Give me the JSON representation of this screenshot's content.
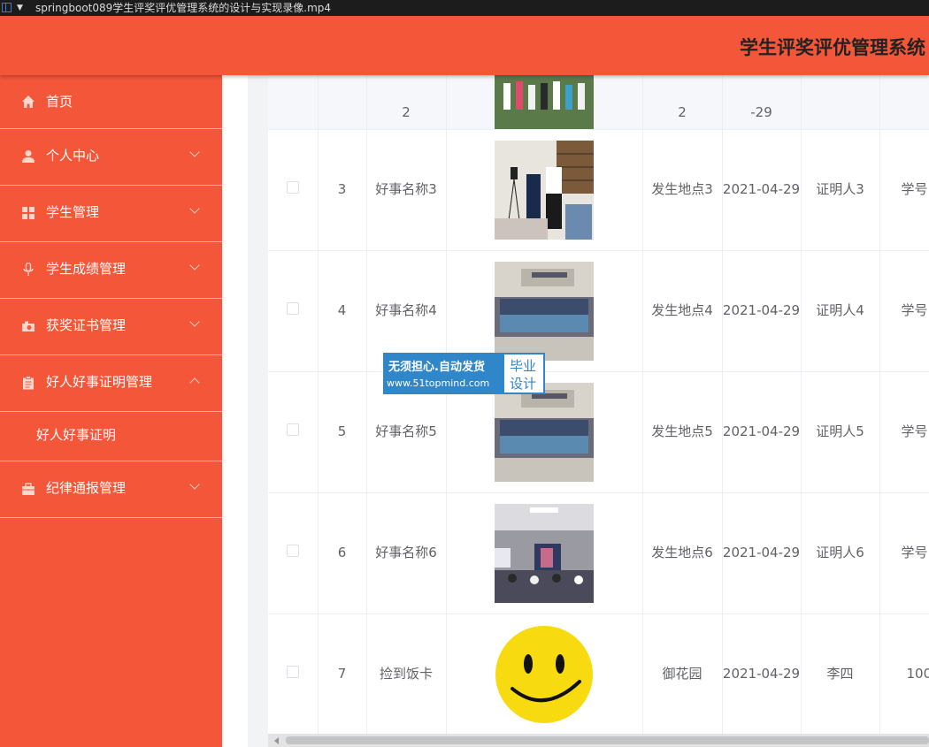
{
  "window": {
    "filename": "springboot089学生评奖评优管理系统的设计与实现录像.mp4"
  },
  "header": {
    "title": "学生评奖评优管理系统"
  },
  "sidebar": {
    "items": [
      {
        "label": "首页",
        "icon": "home-icon"
      },
      {
        "label": "个人中心",
        "icon": "user-icon"
      },
      {
        "label": "学生管理",
        "icon": "grid-icon"
      },
      {
        "label": "学生成绩管理",
        "icon": "microphone-icon"
      },
      {
        "label": "获奖证书管理",
        "icon": "camera-icon"
      },
      {
        "label": "好人好事证明管理",
        "icon": "clipboard-icon"
      },
      {
        "label": "纪律通报管理",
        "icon": "briefcase-icon"
      }
    ],
    "submenu": {
      "label": "好人好事证明"
    }
  },
  "table": {
    "rows": [
      {
        "index": "",
        "name": "2",
        "place": "2",
        "date": "-29",
        "witness": "",
        "student_no": "",
        "image": "group-photo-outdoor"
      },
      {
        "index": "3",
        "name": "好事名称3",
        "place": "发生地点3",
        "date": "2021-04-29",
        "witness": "证明人3",
        "student_no": "学号",
        "image": "meeting-room-photo"
      },
      {
        "index": "4",
        "name": "好事名称4",
        "place": "发生地点4",
        "date": "2021-04-29",
        "witness": "证明人4",
        "student_no": "学号",
        "image": "group-photo-building"
      },
      {
        "index": "5",
        "name": "好事名称5",
        "place": "发生地点5",
        "date": "2021-04-29",
        "witness": "证明人5",
        "student_no": "学号",
        "image": "group-photo-building"
      },
      {
        "index": "6",
        "name": "好事名称6",
        "place": "发生地点6",
        "date": "2021-04-29",
        "witness": "证明人6",
        "student_no": "学号",
        "image": "conference-hall-photo"
      },
      {
        "index": "7",
        "name": "捡到饭卡",
        "place": "御花园",
        "date": "2021-04-29",
        "witness": "李四",
        "student_no": "100",
        "image": "smiley-face"
      }
    ]
  },
  "watermark": {
    "slogan": "无须担心.自动发货",
    "url": "www.51topmind.com",
    "badge_line1": "毕业",
    "badge_line2": "设计"
  },
  "colors": {
    "primary": "#f4563a",
    "divider": "#ffb3a3",
    "text": "#606266",
    "watermark_blue": "#2f86c8",
    "smiley_yellow": "#f7da0f"
  }
}
